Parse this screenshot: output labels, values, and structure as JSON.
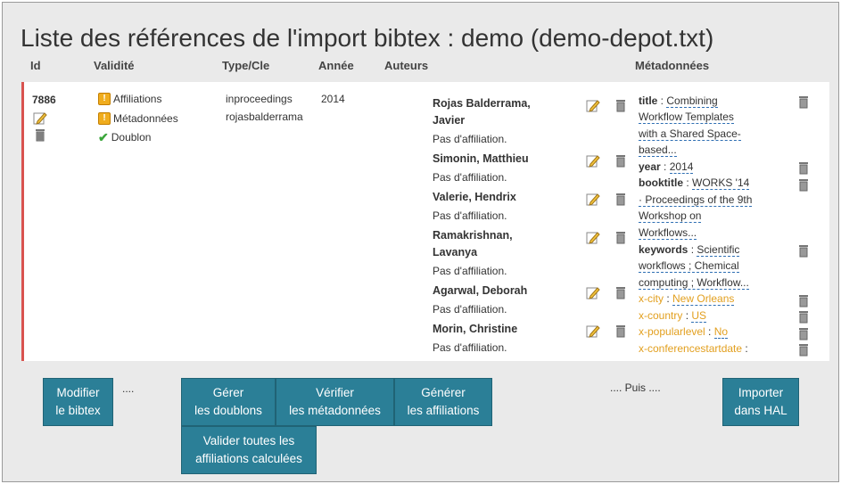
{
  "page": {
    "title": "Liste des références de l'import bibtex : demo (demo-depot.txt)"
  },
  "columns": {
    "id": "Id",
    "validite": "Validité",
    "type": "Type/Cle",
    "annee": "Année",
    "auteurs": "Auteurs",
    "meta": "Métadonnées"
  },
  "record": {
    "id": "7886",
    "validity": [
      {
        "label": "Affiliations",
        "status": "warning"
      },
      {
        "label": "Métadonnées",
        "status": "warning"
      },
      {
        "label": "Doublon",
        "status": "ok"
      }
    ],
    "type": "inproceedings",
    "key": "rojasbalderrama",
    "year": "2014",
    "authors": [
      {
        "name_line1": "Rojas Balderrama,",
        "name_line2": "Javier",
        "affiliation": "Pas d'affiliation."
      },
      {
        "name_line1": "Simonin, Matthieu",
        "name_line2": "",
        "affiliation": "Pas d'affiliation."
      },
      {
        "name_line1": "Valerie, Hendrix",
        "name_line2": "",
        "affiliation": "Pas d'affiliation."
      },
      {
        "name_line1": "Ramakrishnan,",
        "name_line2": "Lavanya",
        "affiliation": "Pas d'affiliation."
      },
      {
        "name_line1": "Agarwal, Deborah",
        "name_line2": "",
        "affiliation": "Pas d'affiliation."
      },
      {
        "name_line1": "Morin, Christine",
        "name_line2": "",
        "affiliation": "Pas d'affiliation."
      }
    ],
    "metadata": {
      "title_key": "title",
      "title_lines": [
        "Combining",
        "Workflow Templates",
        "with a Shared Space-",
        "based..."
      ],
      "year_key": "year",
      "year_val": "2014",
      "booktitle_key": "booktitle",
      "booktitle_lines": [
        "WORKS '14",
        "· Proceedings of the 9th",
        "Workshop on",
        "Workflows..."
      ],
      "keywords_key": "keywords",
      "keywords_lines": [
        "Scientific",
        "workflows ; Chemical",
        "computing ; Workflow..."
      ],
      "xcity_key": "x-city",
      "xcity_val": "New Orleans",
      "xcountry_key": "x-country",
      "xcountry_val": "US",
      "xpop_key": "x-popularlevel",
      "xpop_val": "No",
      "xconf_key": "x-conferencestartdate"
    }
  },
  "actions": {
    "modify": [
      "Modifier",
      "le bibtex"
    ],
    "dots1": "....",
    "doublons": [
      "Gérer",
      "les doublons"
    ],
    "verify": [
      "Vérifier",
      "les métadonnées"
    ],
    "affil": [
      "Générer",
      "les affiliations"
    ],
    "validate": [
      "Valider toutes les",
      "affiliations calculées"
    ],
    "puis": ".... Puis ....",
    "import": [
      "Importer",
      "dans HAL"
    ]
  }
}
